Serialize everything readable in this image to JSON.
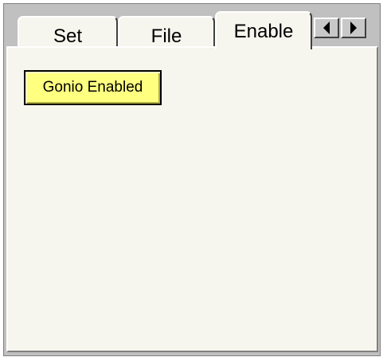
{
  "tabs": [
    {
      "label": "Set",
      "active": false
    },
    {
      "label": "File",
      "active": false
    },
    {
      "label": "Enable",
      "active": true
    }
  ],
  "scroll": {
    "left_icon": "left-arrow-icon",
    "right_icon": "right-arrow-icon"
  },
  "panel": {
    "indicator_label": "Gonio Enabled",
    "indicator_color": "#ffff80"
  }
}
